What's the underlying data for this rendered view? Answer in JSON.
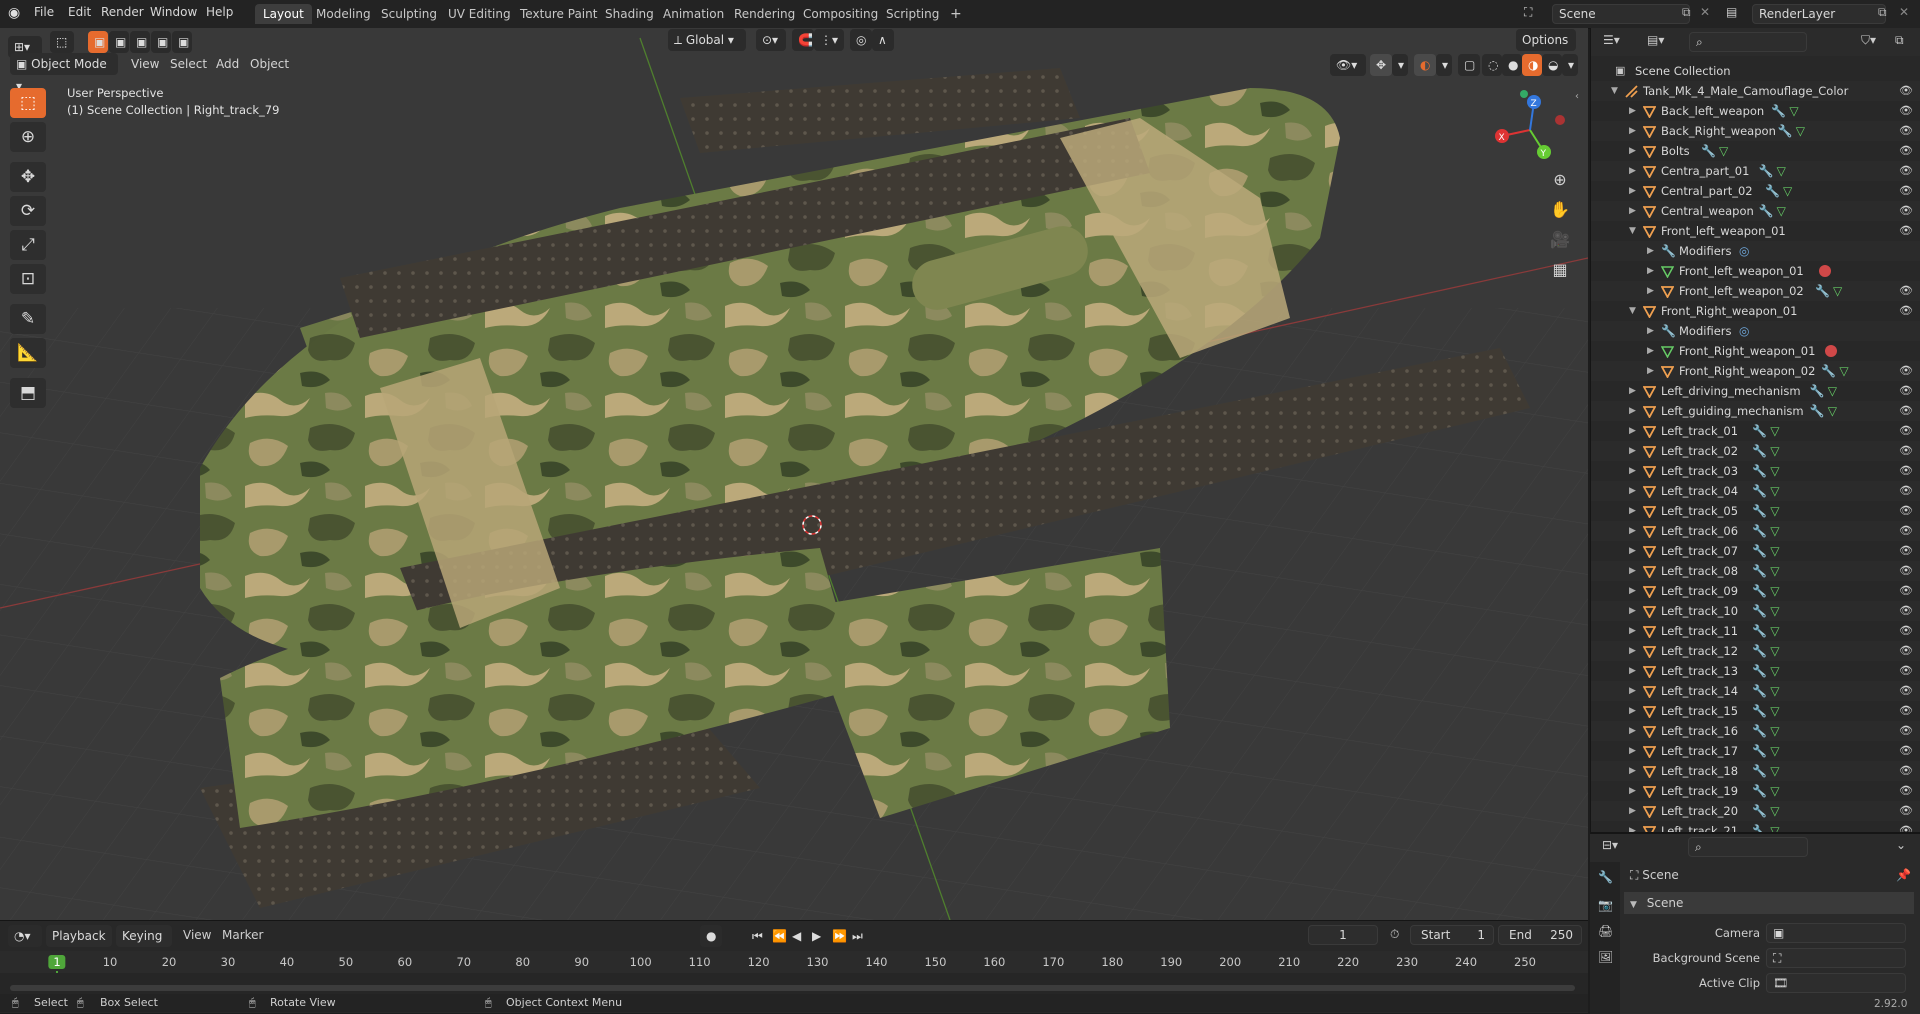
{
  "topbar": {
    "menus": [
      "File",
      "Edit",
      "Render",
      "Window",
      "Help"
    ],
    "workspaces": [
      "Layout",
      "Modeling",
      "Sculpting",
      "UV Editing",
      "Texture Paint",
      "Shading",
      "Animation",
      "Rendering",
      "Compositing",
      "Scripting"
    ],
    "active_workspace": "Layout",
    "add_tab": "+",
    "scene_name": "Scene",
    "view_layer": "RenderLayer"
  },
  "viewport": {
    "mode": "Object Mode",
    "menus": [
      "View",
      "Select",
      "Add",
      "Object"
    ],
    "transform_orientation": "Global",
    "options_label": "Options",
    "overlay_title": "User Perspective",
    "overlay_subtitle": "(1) Scene Collection | Right_track_79",
    "gizmo": {
      "x": "X",
      "y": "Y",
      "z": "Z"
    }
  },
  "outliner": {
    "root": "Scene Collection",
    "rows": [
      {
        "label": "Tank_Mk_4_Male_Camouflage_Color",
        "depth": 1,
        "expanded": true,
        "type": "armature"
      },
      {
        "label": "Back_left_weapon",
        "depth": 2,
        "type": "object",
        "mod": true,
        "mesh": true
      },
      {
        "label": "Back_Right_weapon",
        "depth": 2,
        "type": "object",
        "mod": true,
        "mesh": true
      },
      {
        "label": "Bolts",
        "depth": 2,
        "type": "object",
        "mod": true,
        "mesh": true
      },
      {
        "label": "Centra_part_01",
        "depth": 2,
        "type": "object",
        "mod": true,
        "mesh": true
      },
      {
        "label": "Central_part_02",
        "depth": 2,
        "type": "object",
        "mod": true,
        "mesh": true
      },
      {
        "label": "Central_weapon",
        "depth": 2,
        "type": "object",
        "mod": true,
        "mesh": true
      },
      {
        "label": "Front_left_weapon_01",
        "depth": 2,
        "type": "object",
        "expanded": true
      },
      {
        "label": "Modifiers",
        "depth": 3,
        "type": "modifiers"
      },
      {
        "label": "Front_left_weapon_01",
        "depth": 3,
        "type": "mesh-data"
      },
      {
        "label": "Front_left_weapon_02",
        "depth": 3,
        "type": "object",
        "mod": true,
        "mesh": true
      },
      {
        "label": "Front_Right_weapon_01",
        "depth": 2,
        "type": "object",
        "expanded": true
      },
      {
        "label": "Modifiers",
        "depth": 3,
        "type": "modifiers"
      },
      {
        "label": "Front_Right_weapon_01",
        "depth": 3,
        "type": "mesh-data"
      },
      {
        "label": "Front_Right_weapon_02",
        "depth": 3,
        "type": "object",
        "mod": true,
        "mesh": true
      },
      {
        "label": "Left_driving_mechanism",
        "depth": 2,
        "type": "object",
        "mod": true,
        "mesh": true
      },
      {
        "label": "Left_guiding_mechanism",
        "depth": 2,
        "type": "object",
        "mod": true,
        "mesh": true
      },
      {
        "label": "Left_track_01",
        "depth": 2,
        "type": "object",
        "mod": true,
        "mesh": true
      },
      {
        "label": "Left_track_02",
        "depth": 2,
        "type": "object",
        "mod": true,
        "mesh": true
      },
      {
        "label": "Left_track_03",
        "depth": 2,
        "type": "object",
        "mod": true,
        "mesh": true
      },
      {
        "label": "Left_track_04",
        "depth": 2,
        "type": "object",
        "mod": true,
        "mesh": true
      },
      {
        "label": "Left_track_05",
        "depth": 2,
        "type": "object",
        "mod": true,
        "mesh": true
      },
      {
        "label": "Left_track_06",
        "depth": 2,
        "type": "object",
        "mod": true,
        "mesh": true
      },
      {
        "label": "Left_track_07",
        "depth": 2,
        "type": "object",
        "mod": true,
        "mesh": true
      },
      {
        "label": "Left_track_08",
        "depth": 2,
        "type": "object",
        "mod": true,
        "mesh": true
      },
      {
        "label": "Left_track_09",
        "depth": 2,
        "type": "object",
        "mod": true,
        "mesh": true
      },
      {
        "label": "Left_track_10",
        "depth": 2,
        "type": "object",
        "mod": true,
        "mesh": true
      },
      {
        "label": "Left_track_11",
        "depth": 2,
        "type": "object",
        "mod": true,
        "mesh": true
      },
      {
        "label": "Left_track_12",
        "depth": 2,
        "type": "object",
        "mod": true,
        "mesh": true
      },
      {
        "label": "Left_track_13",
        "depth": 2,
        "type": "object",
        "mod": true,
        "mesh": true
      },
      {
        "label": "Left_track_14",
        "depth": 2,
        "type": "object",
        "mod": true,
        "mesh": true
      },
      {
        "label": "Left_track_15",
        "depth": 2,
        "type": "object",
        "mod": true,
        "mesh": true
      },
      {
        "label": "Left_track_16",
        "depth": 2,
        "type": "object",
        "mod": true,
        "mesh": true
      },
      {
        "label": "Left_track_17",
        "depth": 2,
        "type": "object",
        "mod": true,
        "mesh": true
      },
      {
        "label": "Left_track_18",
        "depth": 2,
        "type": "object",
        "mod": true,
        "mesh": true
      },
      {
        "label": "Left_track_19",
        "depth": 2,
        "type": "object",
        "mod": true,
        "mesh": true
      },
      {
        "label": "Left_track_20",
        "depth": 2,
        "type": "object",
        "mod": true,
        "mesh": true
      },
      {
        "label": "Left_track_21",
        "depth": 2,
        "type": "object",
        "mod": true,
        "mesh": true
      }
    ]
  },
  "properties": {
    "context": "Scene",
    "panel": "Scene",
    "fields": [
      {
        "label": "Camera",
        "value": ""
      },
      {
        "label": "Background Scene",
        "value": ""
      },
      {
        "label": "Active Clip",
        "value": ""
      }
    ],
    "version": "2.92.0"
  },
  "timeline": {
    "menus": [
      "Playback",
      "Keying",
      "View",
      "Marker"
    ],
    "current_frame": "1",
    "start_label": "Start",
    "start": "1",
    "end_label": "End",
    "end": "250",
    "ruler": [
      "1",
      "10",
      "20",
      "30",
      "40",
      "50",
      "60",
      "70",
      "80",
      "90",
      "100",
      "110",
      "120",
      "130",
      "140",
      "150",
      "160",
      "170",
      "180",
      "190",
      "200",
      "210",
      "220",
      "230",
      "240",
      "250"
    ]
  },
  "statusbar": {
    "items": [
      "Select",
      "Box Select",
      "Rotate View",
      "Object Context Menu"
    ]
  },
  "colors": {
    "accent": "#e66b2e",
    "active_frame": "#4fa63a",
    "camo_dark": "#4a5431",
    "camo_green": "#6b7a45",
    "camo_tan": "#bba97a",
    "track": "#3f3a33"
  }
}
